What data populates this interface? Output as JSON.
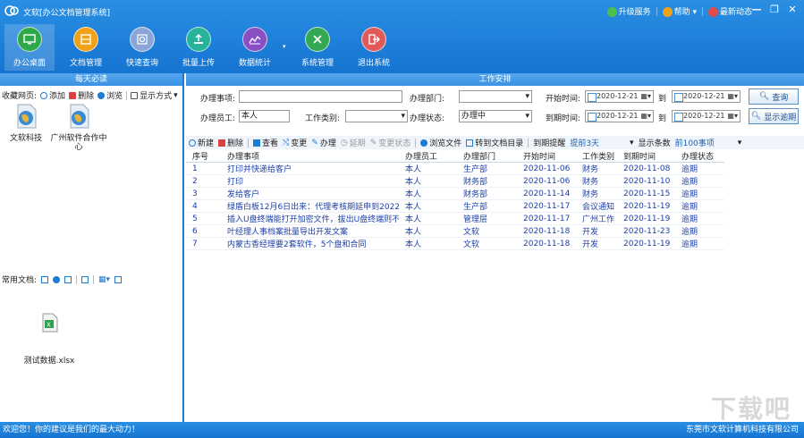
{
  "window": {
    "title": "文软[办公文档管理系统]",
    "links": [
      "升级服务",
      "帮助",
      "最新动态"
    ]
  },
  "toolbar": [
    {
      "label": "办公桌面",
      "color": "#2ea84a",
      "icon": "desktop-icon"
    },
    {
      "label": "文档管理",
      "color": "#f0a21a",
      "icon": "archive-icon"
    },
    {
      "label": "快速查询",
      "color": "#8aa6d8",
      "icon": "search-icon"
    },
    {
      "label": "批量上传",
      "color": "#26b39a",
      "icon": "upload-icon"
    },
    {
      "label": "数据统计",
      "color": "#8b4fc4",
      "icon": "chart-icon"
    },
    {
      "label": "系统管理",
      "color": "#34a853",
      "icon": "tools-icon"
    },
    {
      "label": "退出系统",
      "color": "#e05a5a",
      "icon": "exit-icon"
    }
  ],
  "left": {
    "header": "每天必读",
    "fav_label": "收藏网页:",
    "fav_actions": [
      "添加",
      "删除",
      "浏览",
      "显示方式"
    ],
    "shortcuts": [
      "文软科技",
      "广州软件合作中心"
    ],
    "common_docs_label": "常用文档:",
    "file_name": "测试数据.xlsx"
  },
  "right": {
    "header": "工作安排",
    "form": {
      "task_label": "办理事项:",
      "task_value": "",
      "dept_label": "办理部门:",
      "dept_value": "",
      "start_label": "开始时间:",
      "start_from": "2020-12-21",
      "to1": "到",
      "start_to": "2020-12-21",
      "query_btn": "查询",
      "staff_label": "办理员工:",
      "staff_value": "本人",
      "type_label": "工作类别:",
      "type_value": "",
      "status_label": "办理状态:",
      "status_value": "办理中",
      "due_label": "到期时间:",
      "due_from": "2020-12-21",
      "to2": "到",
      "due_to": "2020-12-21",
      "overdue_btn": "显示逾期"
    },
    "actions": [
      "新建",
      "删除",
      "查看",
      "变更",
      "办理",
      "延期",
      "变更状态",
      "浏览文件",
      "转到文档目录"
    ],
    "remind_label": "到期提醒",
    "remind_value": "提前3天",
    "show_label": "显示条数",
    "show_value": "前100事项",
    "columns": [
      "序号",
      "办理事项",
      "办理员工",
      "办理部门",
      "开始时间",
      "工作类别",
      "到期时间",
      "办理状态"
    ],
    "rows": [
      [
        "1",
        "打印并快递给客户",
        "本人",
        "生产部",
        "2020-11-06",
        "财务",
        "2020-11-08",
        "逾期"
      ],
      [
        "2",
        "打印",
        "本人",
        "财务部",
        "2020-11-06",
        "财务",
        "2020-11-10",
        "逾期"
      ],
      [
        "3",
        "发给客户",
        "本人",
        "财务部",
        "2020-11-14",
        "财务",
        "2020-11-15",
        "逾期"
      ],
      [
        "4",
        "绿盾白板12月6日出来：代理考核期延申到2022...",
        "本人",
        "生产部",
        "2020-11-17",
        "会议通知",
        "2020-11-19",
        "逾期"
      ],
      [
        "5",
        "插入U盘终端能打开加密文件，拔出U盘终端则不...",
        "本人",
        "管理层",
        "2020-11-17",
        "广州工作",
        "2020-11-19",
        "逾期"
      ],
      [
        "6",
        "叶经理人事档案批量导出开发文案",
        "本人",
        "文软",
        "2020-11-18",
        "开发",
        "2020-11-23",
        "逾期"
      ],
      [
        "7",
        "内蒙古香经理要2套软件，5个盘和合同",
        "本人",
        "文软",
        "2020-11-18",
        "开发",
        "2020-11-19",
        "逾期"
      ]
    ]
  },
  "status": {
    "left": "欢迎您！你的建议是我们的最大动力！",
    "right": "东莞市文软计算机科技有限公司"
  },
  "watermark": "下载吧"
}
